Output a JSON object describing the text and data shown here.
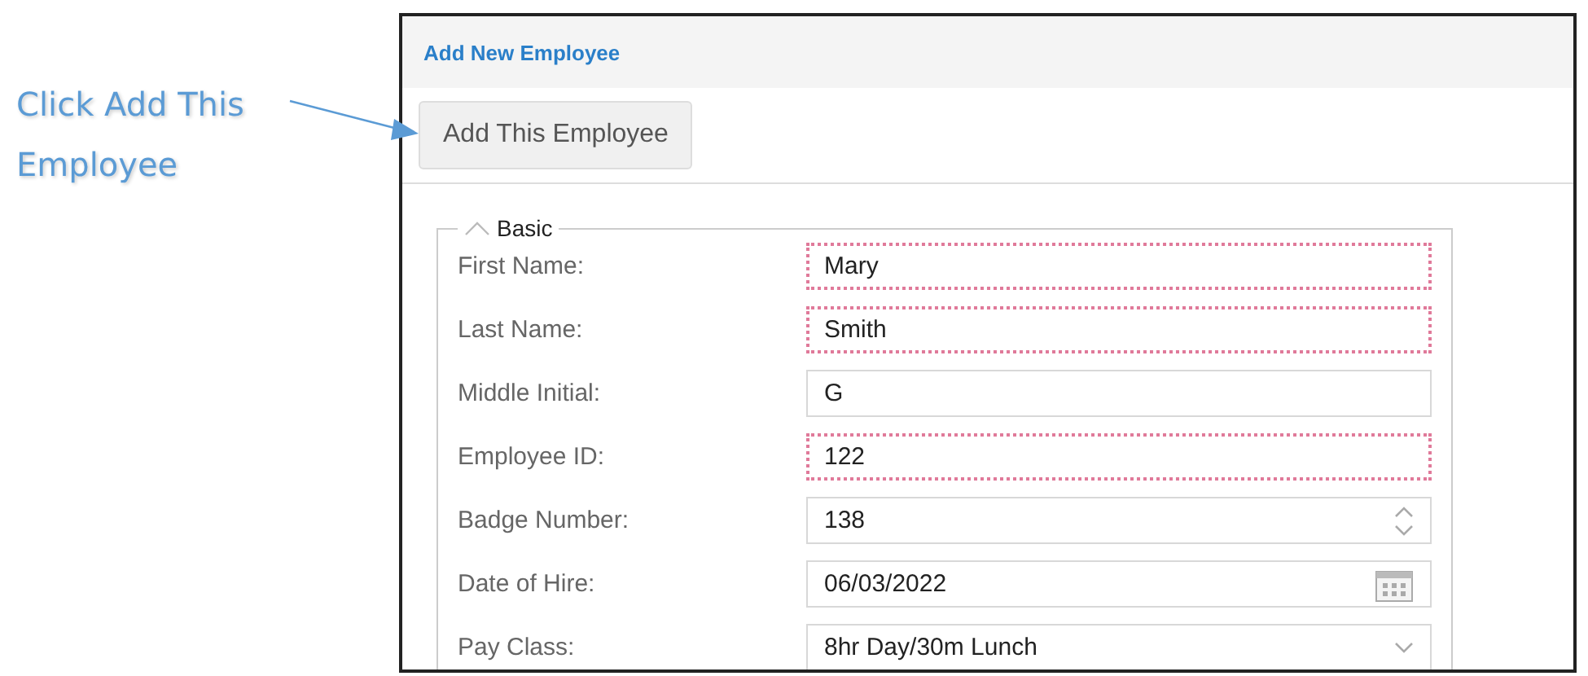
{
  "callout": {
    "text": "Click Add This Employee"
  },
  "window": {
    "title": "Add New Employee"
  },
  "toolbar": {
    "button": "Add This Employee"
  },
  "section": {
    "title": "Basic",
    "expanded": true,
    "fields": [
      {
        "label": "First Name:",
        "value": "Mary",
        "kind": "text",
        "required": true
      },
      {
        "label": "Last Name:",
        "value": "Smith",
        "kind": "text",
        "required": true
      },
      {
        "label": "Middle Initial:",
        "value": "G",
        "kind": "text",
        "required": false
      },
      {
        "label": "Employee ID:",
        "value": "122",
        "kind": "text",
        "required": true
      },
      {
        "label": "Badge Number:",
        "value": "138",
        "kind": "number",
        "required": false
      },
      {
        "label": "Date of Hire:",
        "value": "06/03/2022",
        "kind": "date",
        "required": false
      },
      {
        "label": "Pay Class:",
        "value": "8hr Day/30m Lunch",
        "kind": "select",
        "required": false
      }
    ]
  }
}
